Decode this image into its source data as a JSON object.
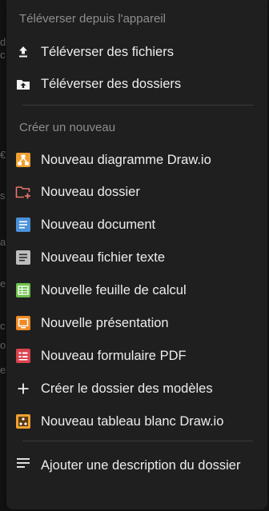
{
  "upload_section": {
    "title": "Téléverser depuis l'appareil",
    "items": [
      {
        "label": "Téléverser des fichiers",
        "icon": "upload-icon"
      },
      {
        "label": "Téléverser des dossiers",
        "icon": "folder-upload-icon"
      }
    ]
  },
  "create_section": {
    "title": "Créer un nouveau",
    "items": [
      {
        "label": "Nouveau diagramme Draw.io",
        "icon": "drawio-diagram-icon",
        "color": "#f0a030"
      },
      {
        "label": "Nouveau dossier",
        "icon": "folder-add-icon",
        "color": "#e8766a"
      },
      {
        "label": "Nouveau document",
        "icon": "document-icon",
        "color": "#4a90d9"
      },
      {
        "label": "Nouveau fichier texte",
        "icon": "text-file-icon",
        "color": "#bdbdbd"
      },
      {
        "label": "Nouvelle feuille de calcul",
        "icon": "spreadsheet-icon",
        "color": "#6cc04a"
      },
      {
        "label": "Nouvelle présentation",
        "icon": "presentation-icon",
        "color": "#f08a24"
      },
      {
        "label": "Nouveau formulaire PDF",
        "icon": "pdf-form-icon",
        "color": "#d9434e"
      },
      {
        "label": "Créer le dossier des modèles",
        "icon": "plus-icon"
      },
      {
        "label": "Nouveau tableau blanc Draw.io",
        "icon": "drawio-whiteboard-icon",
        "color": "#f0a030"
      }
    ]
  },
  "description_item": {
    "label": "Ajouter une description du dossier",
    "icon": "text-lines-icon"
  },
  "background_glyphs": [
    "d",
    "c",
    "€",
    "s",
    "a",
    "e",
    "c",
    "o",
    "e"
  ]
}
